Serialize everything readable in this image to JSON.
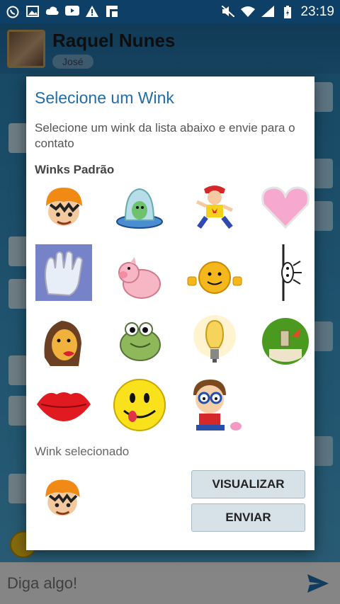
{
  "status_bar": {
    "time": "23:19",
    "left_icons": [
      "whatsapp-icon",
      "gallery-icon",
      "cloud-icon",
      "youtube-icon",
      "warning-icon",
      "flipboard-icon"
    ],
    "right_icons": [
      "mute-icon",
      "wifi-icon",
      "signal-icon",
      "battery-icon"
    ]
  },
  "header": {
    "contact_name": "Raquel Nunes",
    "contact_sub": "José"
  },
  "dialog": {
    "title": "Selecione um Wink",
    "description": "Selecione um wink da lista abaixo e envie para o contato",
    "section_title": "Winks Padrão",
    "winks": [
      "boy-orange-cap-wink",
      "alien-ufo-wink",
      "dancing-boy-wink",
      "pink-heart-wink",
      "hand-print-wink",
      "pig-wink",
      "smiley-hands-wink",
      "peeking-character-wink",
      "girl-kiss-wink",
      "frog-wink",
      "light-bulb-wink",
      "green-circle-character-wink",
      "red-lips-wink",
      "tongue-smiley-wink",
      "sad-boy-icecream-wink"
    ],
    "selected_label": "Wink selecionado",
    "selected_wink": "boy-orange-cap-wink",
    "preview_button": "VISUALIZAR",
    "send_button": "ENVIAR"
  },
  "composer": {
    "placeholder": "Diga algo!",
    "send_icon": "send-icon"
  },
  "colors": {
    "title_blue": "#1f6dab",
    "button_bg": "#d6e2e8",
    "status_bar": "#0e3f66"
  }
}
